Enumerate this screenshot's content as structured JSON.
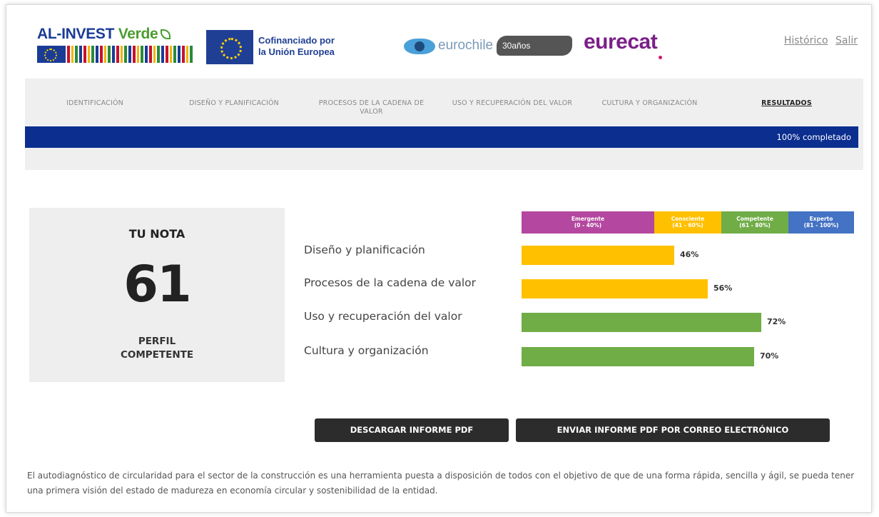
{
  "header": {
    "alinvest": {
      "brand_a": "AL-INVEST",
      "brand_b": "Verde"
    },
    "cofinanciado": {
      "line1": "Cofinanciado por",
      "line2": "la Unión Europea"
    },
    "eurochile": {
      "name": "eurochile",
      "anios": "30años"
    },
    "eurecat": {
      "name": "eurecat"
    },
    "links": {
      "historico": "Histórico",
      "salir": "Salir"
    }
  },
  "nav": {
    "tabs": [
      {
        "label": "IDENTIFICACIÓN"
      },
      {
        "label": "DISEÑO Y PLANIFICACIÓN"
      },
      {
        "label": "PROCESOS DE LA CADENA DE VALOR"
      },
      {
        "label": "USO Y RECUPERACIÓN DEL VALOR"
      },
      {
        "label": "CULTURA Y ORGANIZACIÓN"
      },
      {
        "label": "RESULTADOS"
      }
    ],
    "active_tab": "RESULTADOS",
    "progress_label": "100% completado",
    "progress_fraction": 1.0
  },
  "score": {
    "title": "TU NOTA",
    "value": "61",
    "profile_line1": "PERFIL",
    "profile_line2": "COMPETENTE"
  },
  "chart_data": {
    "type": "bar",
    "orientation": "horizontal",
    "categories": [
      "Diseño y planificación",
      "Procesos de la cadena de valor",
      "Uso y recuperación del valor",
      "Cultura y organización"
    ],
    "values": [
      46,
      56,
      72,
      70
    ],
    "value_labels": [
      "46%",
      "56%",
      "72%",
      "70%"
    ],
    "bar_colors": [
      "#ffc000",
      "#ffc000",
      "#70ad47",
      "#70ad47"
    ],
    "xlim": [
      0,
      100
    ],
    "legend": [
      {
        "name": "Emergente",
        "range": "(0 - 40%)",
        "from": 0,
        "to": 40,
        "color": "#b4479f"
      },
      {
        "name": "Consciente",
        "range": "(41 - 60%)",
        "from": 40,
        "to": 60,
        "color": "#ffc000"
      },
      {
        "name": "Competente",
        "range": "(61 - 80%)",
        "from": 60,
        "to": 80,
        "color": "#70ad47"
      },
      {
        "name": "Experto",
        "range": "(81 - 100%)",
        "from": 80,
        "to": 100,
        "color": "#4472c4"
      }
    ]
  },
  "actions": {
    "download": "DESCARGAR INFORME PDF",
    "email": "ENVIAR INFORME PDF POR CORREO ELECTRÓNICO"
  },
  "footer": {
    "text": "El autodiagnóstico de circularidad para el sector de la construcción es una herramienta puesta a disposición de todos con el objetivo de que de una forma rápida, sencilla y ágil, se pueda tener una primera visión del estado de madureza en economía circular y sostenibilidad de la entidad."
  }
}
